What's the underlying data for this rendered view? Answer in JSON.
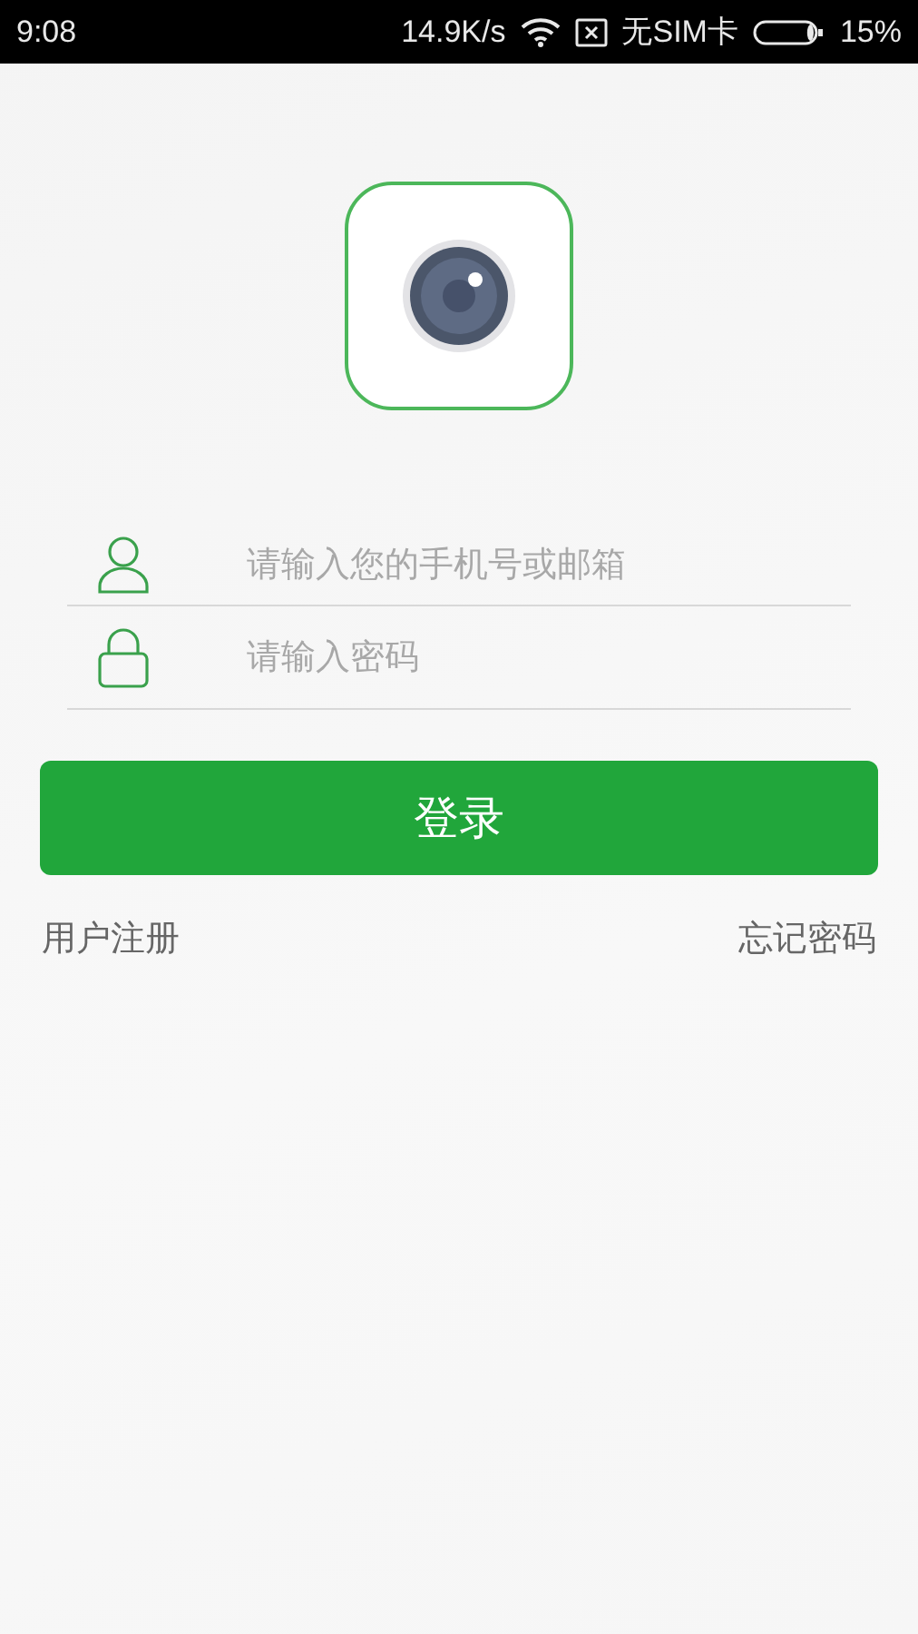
{
  "status_bar": {
    "time": "9:08",
    "speed": "14.9K/s",
    "sim": "无SIM卡",
    "battery": "15%"
  },
  "fields": [
    {
      "kind": "user",
      "placeholder": "请输入您的手机号或邮箱"
    },
    {
      "kind": "password",
      "placeholder": "请输入密码"
    }
  ],
  "login_button": "登录",
  "links": [
    "用户注册",
    "忘记密码"
  ]
}
